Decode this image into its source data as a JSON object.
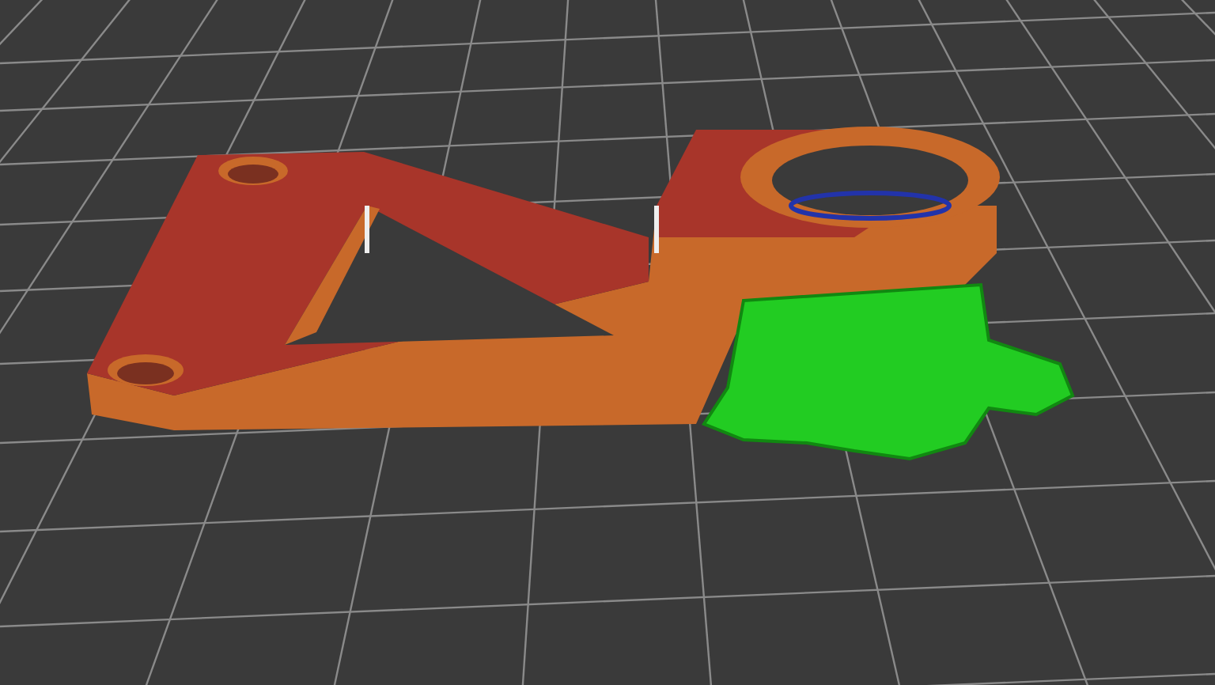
{
  "scene": {
    "kind": "sliced-part-preview"
  }
}
